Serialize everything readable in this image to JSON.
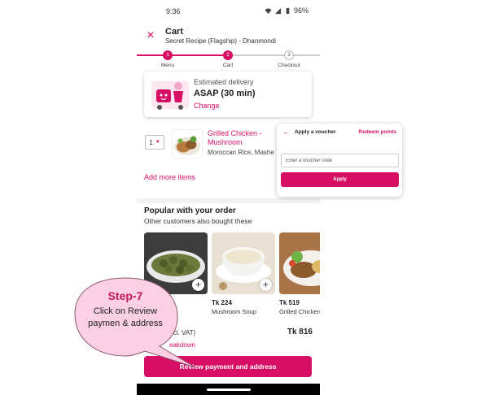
{
  "status_bar": {
    "time": "9:36",
    "battery": "96%"
  },
  "header": {
    "title": "Cart",
    "subtitle": "Secret Recipe (Flagship) - Dhanmondi"
  },
  "stepper": {
    "steps": [
      {
        "number": "1",
        "label": "Menu",
        "state": "done"
      },
      {
        "number": "2",
        "label": "Cart",
        "state": "current"
      },
      {
        "number": "3",
        "label": "Checkout",
        "state": "upcoming"
      }
    ]
  },
  "delivery": {
    "label": "Estimated delivery",
    "time": "ASAP (30 min)",
    "change_label": "Change"
  },
  "cart_item": {
    "quantity": "1",
    "name": "Grilled Chicken - Mushroom",
    "description": "Moroccan Rice, Mashe..."
  },
  "add_more_label": "Add more items",
  "popular": {
    "title": "Popular with your order",
    "subtitle": "Other customers also bought these",
    "items": [
      {
        "price": "",
        "name": ""
      },
      {
        "price": "Tk 224",
        "name": "Mushroom Soup"
      },
      {
        "price": "Tk 519",
        "name": "Grilled Chicken Pepper"
      }
    ]
  },
  "totals": {
    "label": "(incl. VAT)",
    "amount": "Tk 816",
    "breakdown_label": "eakdown"
  },
  "review_button_label": "Review payment and address",
  "voucher": {
    "title": "Apply a voucher",
    "redeem_label": "Redeem points",
    "input_placeholder": "Enter a voucher code",
    "apply_label": "Apply"
  },
  "callout": {
    "title": "Step-7",
    "body": "Click on Review paymen & address"
  },
  "colors": {
    "brand": "#d70f64",
    "callout_fill": "#fbd0e4"
  }
}
